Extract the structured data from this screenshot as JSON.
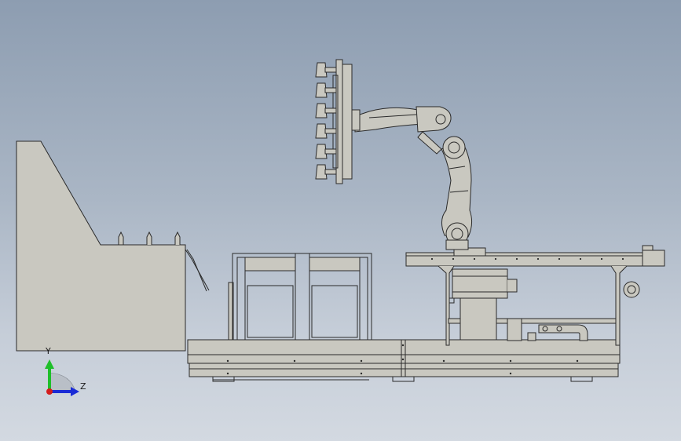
{
  "view": {
    "axis_labels": {
      "y": "Y",
      "z": "Z"
    },
    "colors": {
      "background_top": "#8d9db1",
      "background_bottom": "#d3d9e1",
      "part_fill": "#c9c8c0",
      "outline": "#2a2a2a",
      "axis_y": "#1fbf2a",
      "axis_z": "#1a2bd6",
      "axis_origin": "#d41c1c"
    }
  },
  "scene": {
    "components": [
      "hopper-station",
      "frame-cage",
      "base-platform",
      "conveyor-table",
      "robot-arm",
      "vacuum-gripper",
      "coordinate-triad"
    ]
  }
}
